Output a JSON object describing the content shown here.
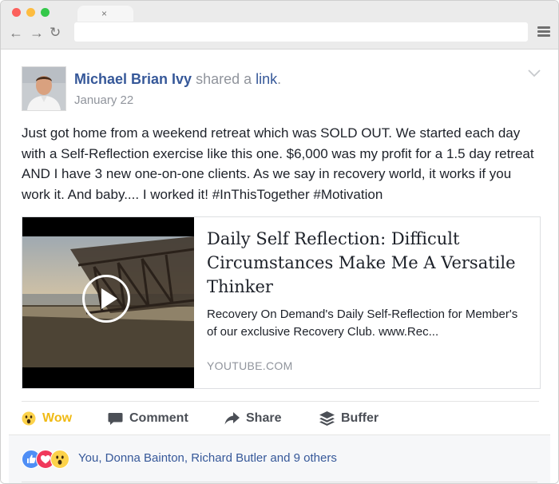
{
  "browser": {
    "tab_close": "×"
  },
  "post": {
    "author": "Michael Brian Ivy",
    "shared_prefix": " shared a ",
    "shared_link": "link",
    "shared_suffix": ".",
    "date": "January 22",
    "text": "Just got home from a weekend retreat which was SOLD OUT. We started each day with a Self-Reflection exercise like this one. $6,000 was my profit for a 1.5 day retreat AND I have 3 new one-on-one clients. As we say in recovery world, it works if you work it. And baby.... I worked it! #InThisTogether #Motivation",
    "attachment": {
      "title": "Daily Self Reflection: Difficult Circumstances Make Me A Versatile Thinker",
      "description": "Recovery On Demand's Daily Self-Reflection for Member's of our exclusive Recovery Club. www.Rec...",
      "domain": "YOUTUBE.COM"
    }
  },
  "actions": {
    "wow": "Wow",
    "comment": "Comment",
    "share": "Share",
    "buffer": "Buffer"
  },
  "reactions_summary": "You, Donna Bainton, Richard Butler and 9 others",
  "colors": {
    "link_blue": "#365899",
    "wow_yellow": "#f0ba15",
    "muted_gray": "#90949c"
  }
}
